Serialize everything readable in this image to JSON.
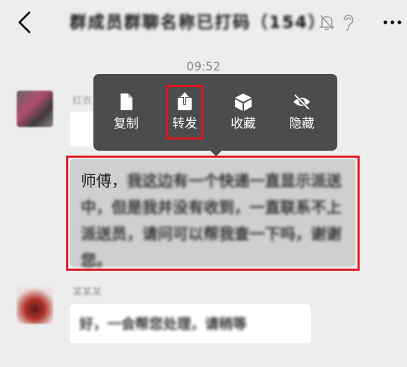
{
  "header": {
    "title": "群成员群聊名称已打码（154）"
  },
  "chat": {
    "timestamp": "09:52",
    "sender_1_name": "红衣",
    "sender_2_name": "某某某",
    "selected_message": {
      "greeting": "师傅，",
      "body": "我这边有一个快递一直显示派送中，但是我并没有收到，一直联系不上派送员，请问可以帮我查一下吗，谢谢您。"
    },
    "next_message": "好，一会帮您处理，请稍等"
  },
  "context_menu": {
    "items": [
      {
        "label": "复制",
        "icon": "copy-icon"
      },
      {
        "label": "转发",
        "icon": "forward-icon"
      },
      {
        "label": "收藏",
        "icon": "collect-icon"
      },
      {
        "label": "隐藏",
        "icon": "hide-icon"
      }
    ],
    "highlighted": "转发"
  },
  "colors": {
    "background": "#ededed",
    "menu": "#4c4c4c",
    "highlight_border": "#e0141e",
    "selected_bubble": "#cfcfcf",
    "bubble": "#ffffff"
  }
}
